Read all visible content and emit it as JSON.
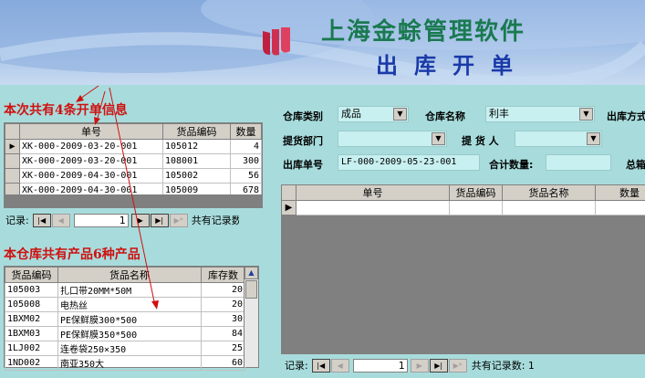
{
  "header": {
    "title_main": "上海金蜍管理软件",
    "title_sub": "出库开单"
  },
  "left": {
    "order_count_label": "本次共有4条开单信息",
    "orders_grid": {
      "columns": [
        "单号",
        "货品编码",
        "数量"
      ],
      "rows": [
        {
          "order": "XK-000-2009-03-20-001",
          "code": "105012",
          "qty": "4"
        },
        {
          "order": "XK-000-2009-03-20-001",
          "code": "108001",
          "qty": "300"
        },
        {
          "order": "XK-000-2009-04-30-001",
          "code": "105002",
          "qty": "56"
        },
        {
          "order": "XK-000-2009-04-30-001",
          "code": "105009",
          "qty": "678"
        }
      ]
    },
    "orders_nav": {
      "label": "记录:",
      "current": "1",
      "total_label": "共有记录数"
    },
    "product_count_label": "本仓库共有产品6种产品",
    "products_grid": {
      "columns": [
        "货品编码",
        "货品名称",
        "库存数"
      ],
      "rows": [
        {
          "code": "105003",
          "name": "扎口带20MM*50M",
          "stock": "20"
        },
        {
          "code": "105008",
          "name": "电热丝",
          "stock": "20"
        },
        {
          "code": "1BXM02",
          "name": "PE保鲜膜300*500",
          "stock": "30"
        },
        {
          "code": "1BXM03",
          "name": "PE保鲜膜350*500",
          "stock": "84"
        },
        {
          "code": "1LJ002",
          "name": "连卷袋250×350",
          "stock": "25"
        },
        {
          "code": "1ND002",
          "name": "南亚350大",
          "stock": "60"
        }
      ]
    }
  },
  "form": {
    "warehouse_type_label": "仓库类别",
    "warehouse_type_value": "成品",
    "warehouse_name_label": "仓库名称",
    "warehouse_name_value": "利丰",
    "outbound_label_cut": "出库方式",
    "pickup_dept_label": "提货部门",
    "pickup_dept_value": "",
    "pickup_person_label": "提 货 人",
    "pickup_person_value": "",
    "outbound_no_label": "出库单号",
    "outbound_no_value": "LF-000-2009-05-23-001",
    "total_qty_label": "合计数量:",
    "total_qty_value": "",
    "total_cut": "总箱"
  },
  "detail_grid": {
    "columns": [
      "单号",
      "货品编码",
      "货品名称",
      "数量"
    ],
    "nav": {
      "label": "记录:",
      "current": "1",
      "total_label": "共有记录数: 1"
    }
  },
  "colors": {
    "background": "#a8dcdc",
    "accent_red": "#d01010",
    "title_green": "#1a7a50",
    "title_blue": "#1a3aa8"
  }
}
